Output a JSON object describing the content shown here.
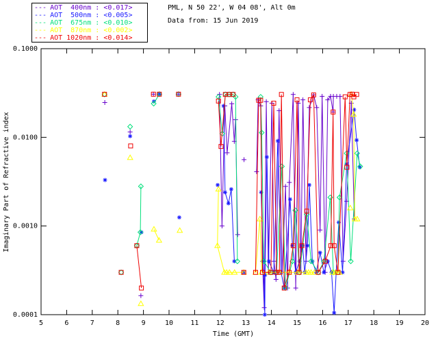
{
  "header": {
    "location": "PML, N 50 22', W 04 08', Alt 0m",
    "date": "Data from: 15 Jun 2019"
  },
  "chart_data": {
    "type": "line",
    "title": "",
    "xlabel": "Time (GMT)",
    "ylabel": "Imaginary Part of Refractive index",
    "legend_position": "top-left",
    "grid": false,
    "x_axis": {
      "min": 5,
      "max": 20,
      "ticks": [
        5,
        6,
        7,
        8,
        9,
        10,
        11,
        12,
        13,
        14,
        15,
        16,
        17,
        18,
        19,
        20
      ]
    },
    "y_axis": {
      "scale": "log",
      "min": 0.0001,
      "max": 0.1,
      "ticks": [
        {
          "label": "0.1000",
          "value": 0.1
        },
        {
          "label": "0.0100",
          "value": 0.01
        },
        {
          "label": "0.0010",
          "value": 0.001
        },
        {
          "label": "0.0001",
          "value": 0.0001
        }
      ]
    },
    "series": [
      {
        "id": "aot-400nm",
        "legend_label": "AOT  400nm : <0.017>",
        "color": "#6600cc",
        "marker": "plus",
        "segments": [
          [
            [
              7.49,
              0.0247
            ]
          ],
          [
            [
              8.48,
              0.0115
            ]
          ],
          [
            [
              8.9,
              0.000164
            ]
          ],
          [
            [
              9.39,
              0.0307
            ]
          ],
          [
            [
              10.37,
              0.0307
            ]
          ],
          [
            [
              11.97,
              0.0305
            ],
            [
              12.07,
              0.001
            ],
            [
              12.18,
              0.0226
            ],
            [
              12.27,
              0.0067
            ],
            [
              12.45,
              0.0239
            ],
            [
              12.55,
              0.009
            ],
            [
              12.6,
              0.0158
            ],
            [
              12.68,
              0.0008
            ]
          ],
          [
            [
              12.93,
              0.0056
            ]
          ],
          [
            [
              13.42,
              0.0041
            ],
            [
              13.48,
              0.0265
            ],
            [
              13.58,
              0.0226
            ],
            [
              13.65,
              0.0004
            ],
            [
              13.72,
              0.00012
            ],
            [
              13.8,
              0.0253
            ],
            [
              13.88,
              0.0003
            ],
            [
              14.02,
              0.0243
            ],
            [
              14.1,
              0.0004
            ],
            [
              14.18,
              0.00025
            ],
            [
              14.3,
              0.02
            ],
            [
              14.42,
              0.0003
            ],
            [
              14.55,
              0.0028
            ],
            [
              14.63,
              0.0002
            ],
            [
              14.7,
              0.0031
            ],
            [
              14.85,
              0.0305
            ],
            [
              14.95,
              0.0002
            ],
            [
              15.05,
              0.0243
            ],
            [
              15.15,
              0.0003
            ],
            [
              15.23,
              0.0265
            ],
            [
              15.35,
              0.0004
            ],
            [
              15.48,
              0.0217
            ],
            [
              15.65,
              0.0301
            ],
            [
              15.77,
              0.0217
            ],
            [
              15.9,
              0.0009
            ],
            [
              15.98,
              0.029
            ],
            [
              16.1,
              0.0003
            ],
            [
              16.2,
              0.0265
            ],
            [
              16.31,
              0.029
            ],
            [
              16.41,
              0.0193
            ],
            [
              16.42,
              0.029
            ],
            [
              16.55,
              0.029
            ],
            [
              16.68,
              0.029
            ],
            [
              16.8,
              0.0004
            ],
            [
              16.94,
              0.0019
            ],
            [
              17.12,
              0.0243
            ],
            [
              17.24,
              0.0012
            ]
          ]
        ]
      },
      {
        "id": "aot-500nm",
        "legend_label": "AOT  500nm : <0.005>",
        "color": "#1a1aff",
        "marker": "asterisk",
        "segments": [
          [
            [
              7.5,
              0.0033
            ]
          ],
          [
            [
              8.48,
              0.0103
            ]
          ],
          [
            [
              8.92,
              0.00085
            ]
          ],
          [
            [
              9.41,
              0.0254
            ]
          ],
          [
            [
              9.62,
              0.0307
            ]
          ],
          [
            [
              10.4,
              0.00125
            ]
          ],
          [
            [
              11.9,
              0.0029
            ]
          ],
          [
            [
              12.13,
              0.0226
            ],
            [
              12.19,
              0.0024
            ],
            [
              12.32,
              0.0018
            ],
            [
              12.43,
              0.0026
            ],
            [
              12.55,
              0.0004
            ]
          ],
          [
            [
              12.92,
              0.0003
            ]
          ],
          [
            [
              13.6,
              0.0024
            ],
            [
              13.68,
              0.0004
            ],
            [
              13.74,
              0.0001
            ],
            [
              13.75,
              0.00028
            ],
            [
              13.82,
              0.006
            ],
            [
              13.9,
              0.0004
            ],
            [
              14.09,
              0.0003
            ],
            [
              14.25,
              0.0091
            ],
            [
              14.38,
              0.0003
            ],
            [
              14.5,
              0.0002
            ],
            [
              14.73,
              0.002
            ],
            [
              14.82,
              0.0006
            ],
            [
              14.95,
              0.0003
            ],
            [
              15.1,
              0.0004
            ],
            [
              15.22,
              0.0006
            ],
            [
              15.3,
              0.0003
            ],
            [
              15.41,
              0.0006
            ],
            [
              15.48,
              0.0029
            ],
            [
              15.6,
              0.0004
            ],
            [
              15.75,
              0.0003
            ],
            [
              15.9,
              0.0005
            ],
            [
              16.05,
              0.0003
            ],
            [
              16.2,
              0.0004
            ],
            [
              16.35,
              0.0003
            ],
            [
              16.45,
              0.000105
            ],
            [
              16.63,
              0.0011
            ],
            [
              16.78,
              0.0003
            ],
            [
              16.94,
              0.005
            ],
            [
              17.23,
              0.0205
            ],
            [
              17.33,
              0.0093
            ],
            [
              17.45,
              0.0046
            ]
          ]
        ]
      },
      {
        "id": "aot-675nm",
        "legend_label": "AOT  675nm : <0.010>",
        "color": "#00e07a",
        "marker": "diamond",
        "segments": [
          [
            [
              7.48,
              0.0305
            ]
          ],
          [
            [
              8.13,
              0.0003
            ]
          ],
          [
            [
              8.48,
              0.0132
            ]
          ],
          [
            [
              8.74,
              0.0006
            ],
            [
              8.88,
              0.00085
            ],
            [
              8.9,
              0.0028
            ]
          ],
          [
            [
              9.4,
              0.024
            ],
            [
              9.62,
              0.0307
            ]
          ],
          [
            [
              10.37,
              0.0307
            ]
          ],
          [
            [
              11.93,
              0.0286
            ],
            [
              12.08,
              0.011
            ],
            [
              12.2,
              0.0305
            ],
            [
              12.35,
              0.0305
            ],
            [
              12.5,
              0.0305
            ],
            [
              12.6,
              0.0286
            ],
            [
              12.67,
              0.0004
            ]
          ],
          [
            [
              13.58,
              0.0286
            ],
            [
              13.62,
              0.0113
            ],
            [
              13.7,
              0.0004
            ],
            [
              13.98,
              0.0003
            ],
            [
              14.2,
              0.0003
            ],
            [
              14.41,
              0.0047
            ],
            [
              14.55,
              0.0002
            ],
            [
              14.82,
              0.0004
            ],
            [
              14.93,
              0.0015
            ],
            [
              15.1,
              0.0003
            ],
            [
              15.38,
              0.00135
            ],
            [
              15.55,
              0.0004
            ],
            [
              15.83,
              0.0003
            ],
            [
              16.05,
              0.0004
            ],
            [
              16.3,
              0.0021
            ],
            [
              16.42,
              0.0003
            ],
            [
              16.6,
              0.0003
            ],
            [
              16.66,
              0.0021
            ],
            [
              16.94,
              0.0066
            ],
            [
              17.1,
              0.0004
            ],
            [
              17.35,
              0.0066
            ],
            [
              17.47,
              0.0047
            ]
          ]
        ]
      },
      {
        "id": "aot-870nm",
        "legend_label": "AOT  870nm : <0.002>",
        "color": "#ffff00",
        "marker": "triangle",
        "segments": [
          [
            [
              7.48,
              0.0305
            ]
          ],
          [
            [
              8.48,
              0.0059
            ]
          ],
          [
            [
              8.9,
              0.000133
            ]
          ],
          [
            [
              9.41,
              0.00092
            ],
            [
              9.61,
              0.00069
            ]
          ],
          [
            [
              10.42,
              0.00089
            ]
          ],
          [
            [
              11.93,
              0.0026
            ],
            [
              11.89,
              0.0006
            ],
            [
              12.16,
              0.0003
            ],
            [
              12.25,
              0.0003
            ],
            [
              12.36,
              0.0003
            ],
            [
              12.56,
              0.0003
            ],
            [
              12.92,
              0.0003
            ]
          ],
          [
            [
              13.38,
              0.0003
            ],
            [
              13.55,
              0.0012
            ],
            [
              13.62,
              0.0003
            ],
            [
              13.9,
              0.0003
            ],
            [
              14.31,
              0.0003
            ],
            [
              14.69,
              0.0003
            ],
            [
              15.02,
              0.0003
            ],
            [
              15.35,
              0.0003
            ],
            [
              15.45,
              0.0003
            ],
            [
              15.55,
              0.0003
            ],
            [
              15.68,
              0.0003
            ]
          ],
          [
            [
              16.39,
              0.0003
            ],
            [
              16.5,
              0.0003
            ],
            [
              16.6,
              0.0003
            ],
            [
              16.66,
              0.0003
            ]
          ],
          [
            [
              17.08,
              0.0016
            ]
          ],
          [
            [
              17.12,
              0.0305
            ],
            [
              17.21,
              0.0182
            ],
            [
              17.26,
              0.0012
            ],
            [
              17.35,
              0.0012
            ]
          ]
        ]
      },
      {
        "id": "aot-1020nm",
        "legend_label": "AOT 1020nm : <0.014>",
        "color": "#ee0000",
        "marker": "square",
        "segments": [
          [
            [
              7.48,
              0.0306
            ]
          ],
          [
            [
              8.13,
              0.0003
            ]
          ],
          [
            [
              8.5,
              0.008
            ]
          ],
          [
            [
              8.74,
              0.0006
            ],
            [
              8.92,
              0.0002
            ]
          ],
          [
            [
              9.39,
              0.0307
            ]
          ],
          [
            [
              9.62,
              0.0307
            ]
          ],
          [
            [
              10.37,
              0.0307
            ]
          ],
          [
            [
              11.93,
              0.0257
            ],
            [
              12.03,
              0.0079
            ],
            [
              12.2,
              0.0305
            ],
            [
              12.35,
              0.0305
            ],
            [
              12.5,
              0.0305
            ]
          ],
          [
            [
              12.92,
              0.0003
            ]
          ],
          [
            [
              13.38,
              0.0003
            ],
            [
              13.5,
              0.0262
            ],
            [
              13.58,
              0.0262
            ],
            [
              13.65,
              0.0003
            ],
            [
              13.98,
              0.0003
            ],
            [
              14.09,
              0.0243
            ],
            [
              14.2,
              0.0003
            ],
            [
              14.31,
              0.0003
            ],
            [
              14.39,
              0.0305
            ],
            [
              14.5,
              0.0002
            ],
            [
              14.69,
              0.0003
            ],
            [
              14.85,
              0.0006
            ],
            [
              15.0,
              0.0265
            ],
            [
              15.08,
              0.0003
            ],
            [
              15.19,
              0.0006
            ],
            [
              15.38,
              0.00147
            ],
            [
              15.52,
              0.0265
            ],
            [
              15.65,
              0.0301
            ],
            [
              15.83,
              0.0003
            ],
            [
              16.1,
              0.0004
            ],
            [
              16.32,
              0.0006
            ],
            [
              16.41,
              0.0193
            ],
            [
              16.45,
              0.0006
            ],
            [
              16.6,
              0.0003
            ],
            [
              16.88,
              0.0286
            ],
            [
              16.95,
              0.0046
            ],
            [
              17.07,
              0.0305
            ],
            [
              17.15,
              0.0307
            ],
            [
              17.22,
              0.0286
            ],
            [
              17.33,
              0.0305
            ]
          ]
        ]
      }
    ]
  }
}
